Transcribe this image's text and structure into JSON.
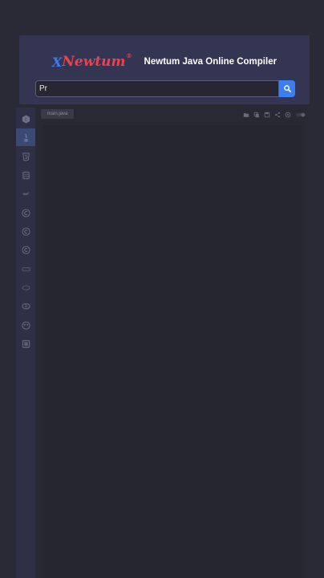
{
  "header": {
    "logo_text": "Newtum",
    "logo_mark": "X",
    "logo_registered": "®",
    "title": "Newtum Java Online Compiler"
  },
  "search": {
    "value": "Pr",
    "button_icon": "search-icon"
  },
  "sidebar": {
    "items": [
      {
        "icon": "cpp-icon"
      },
      {
        "icon": "java-icon"
      },
      {
        "icon": "html5-icon"
      },
      {
        "icon": "database-icon"
      },
      {
        "icon": "swift-icon"
      },
      {
        "icon": "c-lang-icon"
      },
      {
        "icon": "csharp-icon"
      },
      {
        "icon": "cpp-alt-icon"
      },
      {
        "icon": "dotnet-icon"
      },
      {
        "icon": "php-icon"
      },
      {
        "icon": "r-lang-icon"
      },
      {
        "icon": "go-icon"
      },
      {
        "icon": "js-icon"
      }
    ]
  },
  "editor": {
    "file_tab": "main.java",
    "toolbar": [
      "folder-icon",
      "copy-icon",
      "save-icon",
      "share-icon",
      "settings-icon",
      "theme-toggle-icon"
    ]
  },
  "colors": {
    "accent": "#3d7ff2",
    "logo_red": "#e8434f",
    "header_bg": "#343453",
    "page_bg": "#2a2a36"
  }
}
